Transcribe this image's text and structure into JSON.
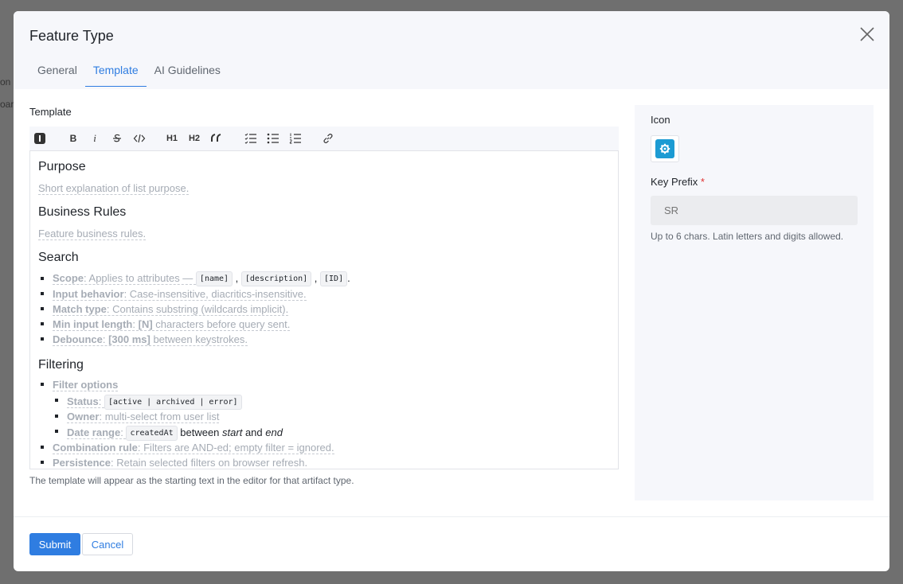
{
  "background": {
    "text1": "on",
    "text2": "oar"
  },
  "dialog": {
    "title": "Feature Type",
    "tabs": [
      {
        "label": "General",
        "active": false
      },
      {
        "label": "Template",
        "active": true
      },
      {
        "label": "AI Guidelines",
        "active": false
      }
    ]
  },
  "template": {
    "label": "Template",
    "toolbar": {
      "icons": [
        "info-icon",
        "bold-icon",
        "italic-icon",
        "strikethrough-icon",
        "code-icon",
        "heading1-icon",
        "heading2-icon",
        "quote-icon",
        "checklist-icon",
        "bullet-list-icon",
        "numbered-list-icon",
        "link-icon"
      ],
      "h1": "H1",
      "h2": "H2",
      "bold": "B",
      "italic": "i"
    },
    "sections": {
      "purpose": {
        "heading": "Purpose",
        "placeholder": "Short explanation of list purpose."
      },
      "business": {
        "heading": "Business Rules",
        "placeholder": "Feature business rules."
      },
      "search": {
        "heading": "Search",
        "scope_label": "Scope",
        "scope_text": ": Applies to attributes — ",
        "scope_codes": [
          "[name]",
          "[description]",
          "[ID]"
        ],
        "input_label": "Input behavior",
        "input_text": ": Case-insensitive, diacritics-insensitive.",
        "match_label": "Match type",
        "match_text": ": Contains substring (wildcards implicit).",
        "min_label": "Min input length",
        "min_text": ": ",
        "min_value": "[N]",
        "min_rest": " characters before query sent.",
        "debounce_label": "Debounce",
        "debounce_text": ": ",
        "debounce_value": "[300 ms]",
        "debounce_rest": " between keystrokes."
      },
      "filtering": {
        "heading": "Filtering",
        "options_label": "Filter options",
        "status_label": "Status",
        "status_code": "[active | archived | error]",
        "owner_label": "Owner",
        "owner_text": ": multi-select from user list",
        "date_label": "Date range",
        "date_code": "createdAt",
        "date_between": "between",
        "date_start": "start",
        "date_and": "and",
        "date_end": "end",
        "combo_label": "Combination rule",
        "combo_text": ": Filters are AND-ed; empty filter = ignored.",
        "persist_label": "Persistence",
        "persist_text": ": Retain selected filters on browser refresh."
      }
    },
    "help": "The template will appear as the starting text in the editor for that artifact type."
  },
  "side": {
    "icon_label": "Icon",
    "icon_name": "gear-icon",
    "icon_color": "#1c9bd3",
    "key_prefix_label": "Key Prefix",
    "required_mark": "*",
    "key_prefix_placeholder": "SR",
    "key_prefix_help": "Up to 6 chars. Latin letters and digits allowed."
  },
  "footer": {
    "submit": "Submit",
    "cancel": "Cancel"
  }
}
